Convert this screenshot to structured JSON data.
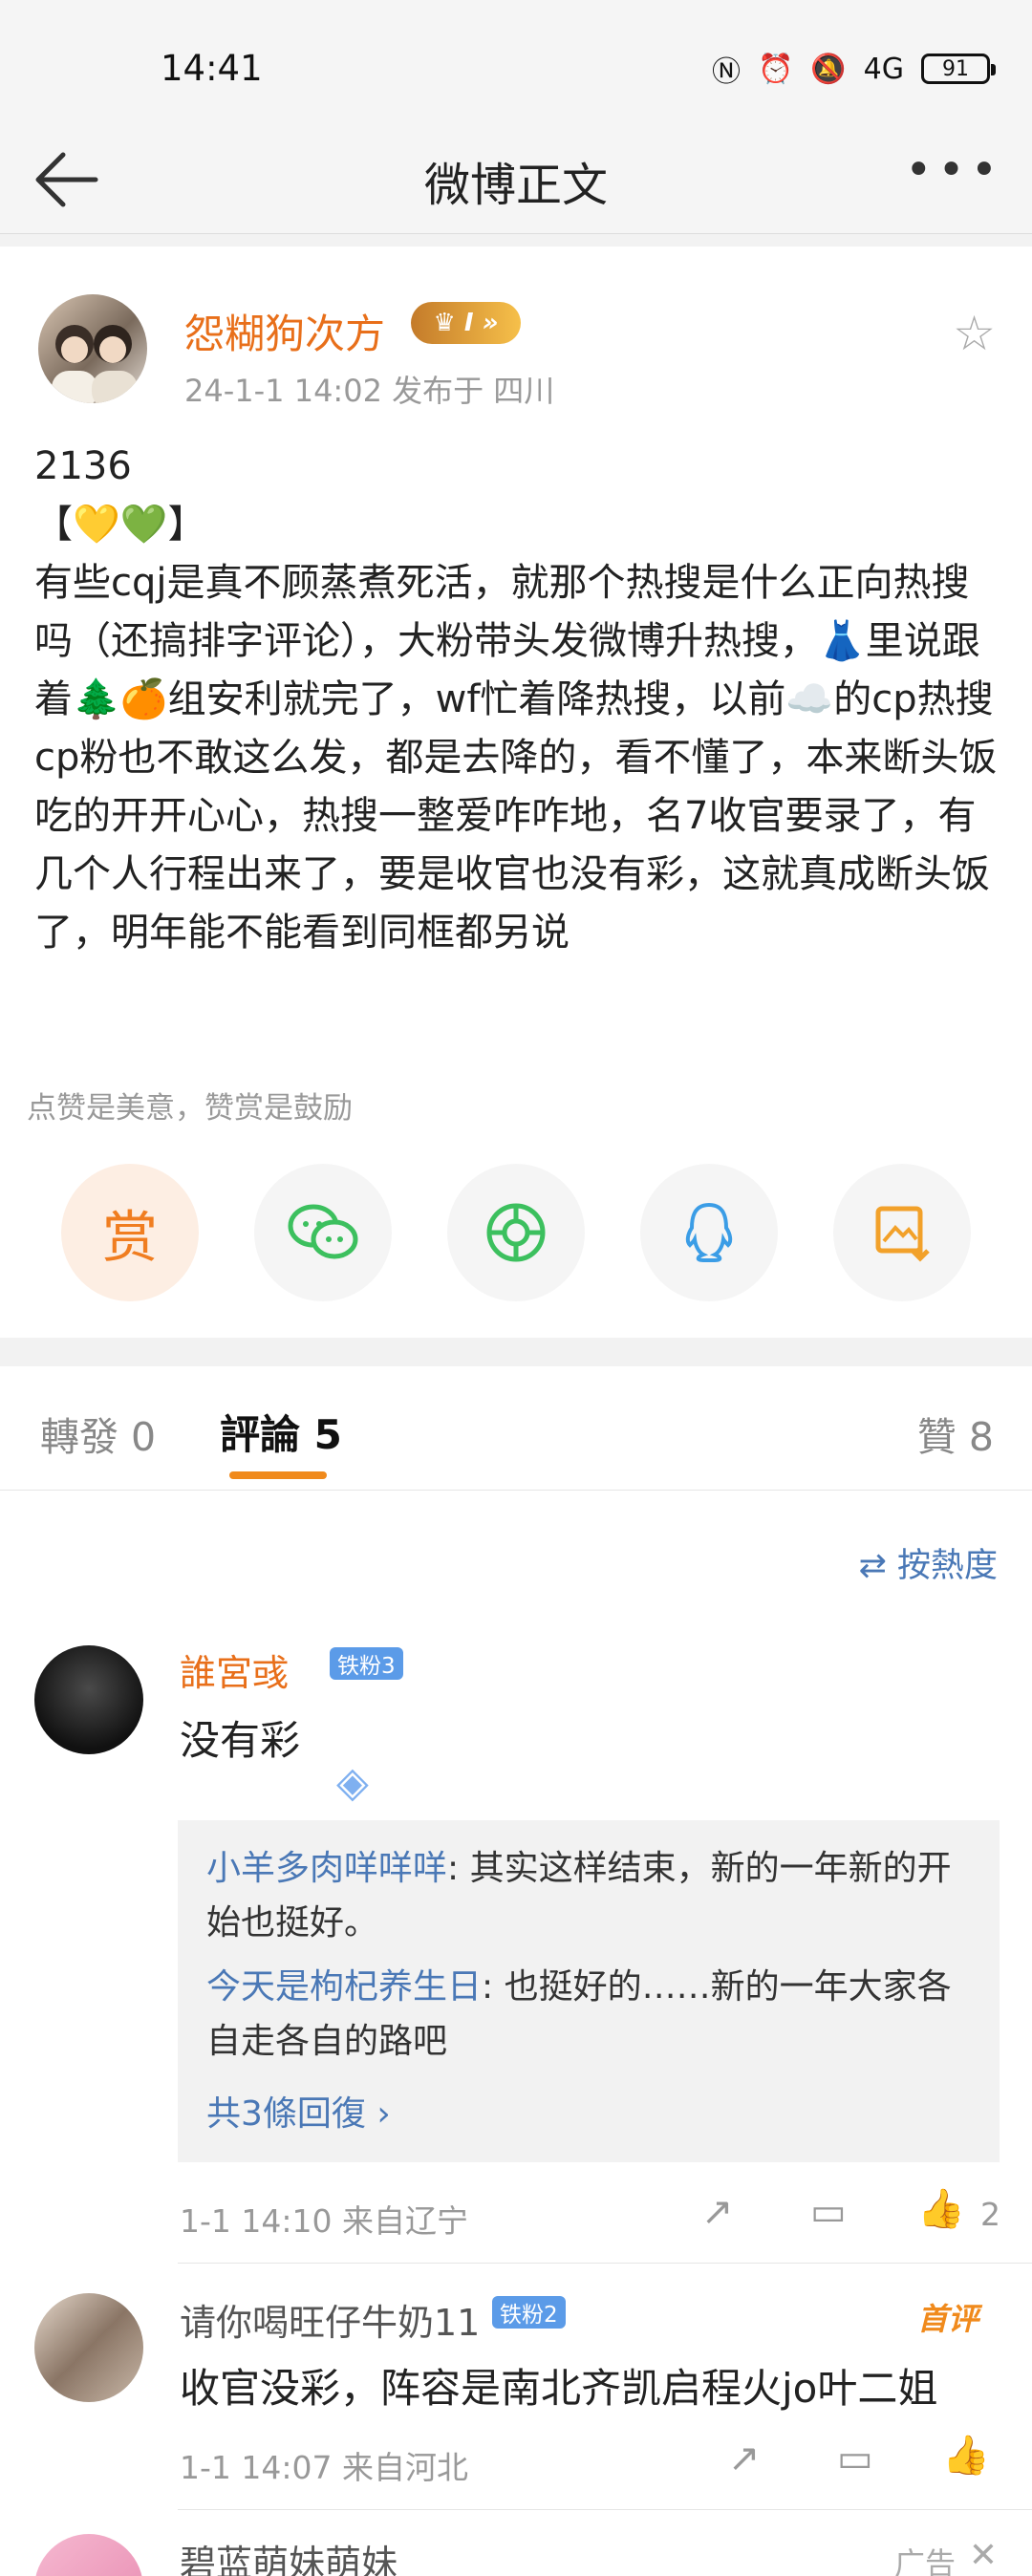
{
  "status": {
    "time": "14:41",
    "signal": "4G",
    "battery": "91"
  },
  "nav": {
    "title": "微博正文"
  },
  "post": {
    "author": "怨糊狗次方",
    "vip_level": "I",
    "meta": "24-1-1 14:02   发布于 四川",
    "body": "2136\n【💛💚】\n有些cqj是真不顾蒸煮死活，就那个热搜是什么正向热搜吗（还搞排字评论），大粉带头发微博升热搜，👗里说跟着🌲🍊组安利就完了，wf忙着降热搜，以前☁️的cp热搜cp粉也不敢这么发，都是去降的，看不懂了，本来断头饭吃的开开心心，热搜一整爱咋咋地，名7收官要录了，有几个人行程出来了，要是收官也没有彩，这就真成断头饭了，明年能不能看到同框都另说",
    "reward_tip": "点赞是美意，赞赏是鼓励",
    "reward_label": "赏"
  },
  "tabs": {
    "repost": "轉發 0",
    "comments": "評論 5",
    "likes": "贊 8"
  },
  "sort_label": "按熱度",
  "comments": [
    {
      "name": "誰宮彧",
      "badge": "铁粉3",
      "text": "没有彩",
      "replies": [
        {
          "name": "小羊多肉咩咩咩",
          "text": ": 其实这样结束，新的一年新的开始也挺好。"
        },
        {
          "name": "今天是枸杞养生日",
          "text": ": 也挺好的……新的一年大家各自走各自的路吧"
        }
      ],
      "more_replies": "共3條回復 ›",
      "time": "1-1 14:10  来自辽宁",
      "likes": "2"
    },
    {
      "name": "请你喝旺仔牛奶11",
      "badge": "铁粉2",
      "first_tag": "首评",
      "text": "收官没彩，阵容是南北齐凯启程火jo叶二姐",
      "time": "1-1 14:07  来自河北"
    },
    {
      "name": "碧蓝萌妹萌妹",
      "ad_label": "广告"
    }
  ],
  "colors": {
    "accent": "#f08a1c",
    "link": "#4a78b6",
    "username": "#e86f1a"
  }
}
